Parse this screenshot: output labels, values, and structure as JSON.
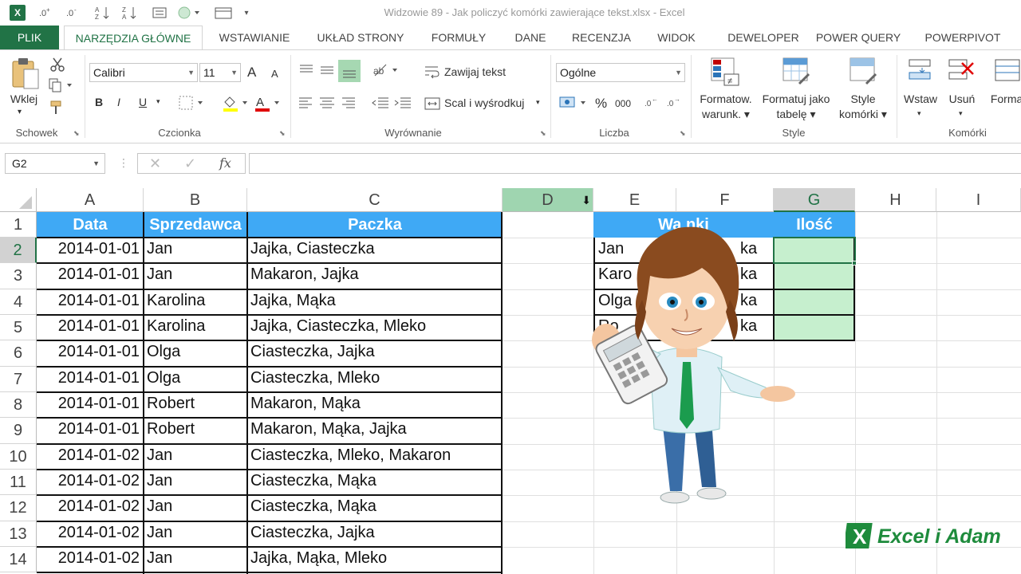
{
  "window": {
    "title": "Widzowie 89 - Jak policzyć komórki zawierające tekst.xlsx - Excel",
    "app_icon": "X"
  },
  "tabs": [
    "PLIK",
    "NARZĘDZIA GŁÓWNE",
    "WSTAWIANIE",
    "UKŁAD STRONY",
    "FORMUŁY",
    "DANE",
    "RECENZJA",
    "WIDOK",
    "DEWELOPER",
    "POWER QUERY",
    "POWERPIVOT"
  ],
  "ribbon": {
    "clipboard": {
      "paste": "Wklej",
      "group": "Schowek"
    },
    "font": {
      "name": "Calibri",
      "size": "11",
      "group": "Czcionka",
      "bold": "B",
      "italic": "I",
      "underline": "U",
      "grow": "A",
      "shrink": "A",
      "color_letter": "A"
    },
    "alignment": {
      "wrap": "Zawijaj tekst",
      "merge": "Scal i wyśrodkuj",
      "group": "Wyrównanie"
    },
    "number": {
      "format": "Ogólne",
      "group": "Liczba",
      "percent": "%",
      "thousands": "000"
    },
    "styles": {
      "cond": "Formatow. warunk.",
      "cond_l1": "Formatow.",
      "cond_l2": "warunk.",
      "table_l1": "Formatuj jako",
      "table_l2": "tabelę",
      "cell_l1": "Style",
      "cell_l2": "komórki",
      "group": "Style"
    },
    "cells": {
      "insert": "Wstaw",
      "delete": "Usuń",
      "format": "Format",
      "group": "Komórki"
    }
  },
  "formula_bar": {
    "name_box": "G2",
    "fx": "fx",
    "formula": ""
  },
  "columns": [
    "A",
    "B",
    "C",
    "D",
    "E",
    "F",
    "G",
    "H",
    "I"
  ],
  "rows": [
    "1",
    "2",
    "3",
    "4",
    "5",
    "6",
    "7",
    "8",
    "9",
    "10",
    "11",
    "12",
    "13",
    "14"
  ],
  "table": {
    "headers": [
      "Data",
      "Sprzedawca",
      "Paczka"
    ],
    "rows": [
      [
        "2014-01-01",
        "Jan",
        "Jajka, Ciasteczka"
      ],
      [
        "2014-01-01",
        "Jan",
        "Makaron, Jajka"
      ],
      [
        "2014-01-01",
        "Karolina",
        "Jajka, Mąka"
      ],
      [
        "2014-01-01",
        "Karolina",
        "Jajka, Ciasteczka, Mleko"
      ],
      [
        "2014-01-01",
        "Olga",
        "Ciasteczka, Jajka"
      ],
      [
        "2014-01-01",
        "Olga",
        "Ciasteczka, Mleko"
      ],
      [
        "2014-01-01",
        "Robert",
        "Makaron, Mąka"
      ],
      [
        "2014-01-01",
        "Robert",
        "Makaron, Mąka, Jajka"
      ],
      [
        "2014-01-02",
        "Jan",
        "Ciasteczka, Mleko, Makaron"
      ],
      [
        "2014-01-02",
        "Jan",
        "Ciasteczka, Mąka"
      ],
      [
        "2014-01-02",
        "Jan",
        "Ciasteczka, Mąka"
      ],
      [
        "2014-01-02",
        "Jan",
        "Ciasteczka, Jajka"
      ],
      [
        "2014-01-02",
        "Jan",
        "Jajka, Mąka, Mleko"
      ]
    ]
  },
  "conditions": {
    "headers": [
      "Warunki",
      "Ilość"
    ],
    "header_visible": "Wa   nki",
    "rows": [
      [
        "Jan",
        "ka"
      ],
      [
        "Karo",
        "ka"
      ],
      [
        "Olga",
        "ka"
      ],
      [
        "Ro",
        "ka"
      ]
    ]
  },
  "watermark": "Excel i Adam",
  "colors": {
    "excel_green": "#217346",
    "header_blue": "#3fa9f5",
    "cell_green": "#c6efce"
  }
}
